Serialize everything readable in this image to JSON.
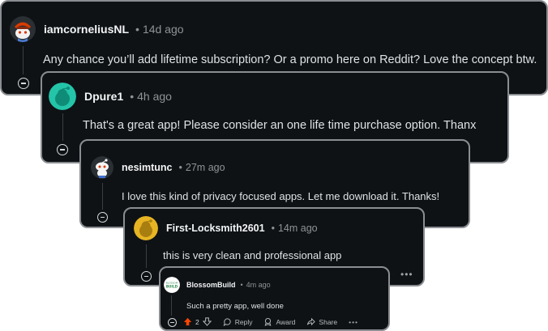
{
  "comments": [
    {
      "username": "iamcorneliusNL",
      "time": "14d ago",
      "text": "Any chance you’ll add lifetime subscription? Or a promo here on Reddit? Love the concept btw.",
      "avatar": "redditor-avatar-red-hat",
      "accent": "#d93a00"
    },
    {
      "username": "Dpure1",
      "time": "4h ago",
      "text": "That's a great app! Please consider an one life time purchase option. Thanx",
      "avatar": "default-snoo-avatar",
      "accent": "#24c4a8"
    },
    {
      "username": "nesimtunc",
      "time": "27m ago",
      "text": "I love this kind of privacy focused apps. Let me download it. Thanks!",
      "avatar": "snoo-avatar-white",
      "accent": "#ffffff"
    },
    {
      "username": "First-Locksmith2601",
      "time": "14m ago",
      "text": "this is very clean and professional app",
      "avatar": "default-snoo-avatar",
      "accent": "#d9a81b",
      "more_label": "•••"
    },
    {
      "username": "BlossomBuild",
      "time": "4m ago",
      "text": "Such a pretty app, well done",
      "avatar": "blossombuild-logo",
      "logo_text": "BLOSSOM BUILD",
      "accent": "#3aa35c",
      "actions": {
        "vote_count": "2",
        "reply_label": "Reply",
        "award_label": "Award",
        "share_label": "Share",
        "more_label": "•••"
      }
    }
  ],
  "separator": "•",
  "colors": {
    "card_bg": "#0f1215",
    "card_border": "#8a8d91",
    "upvote": "#ff4500",
    "text": "#e7e9eb",
    "muted": "#8f9396"
  }
}
